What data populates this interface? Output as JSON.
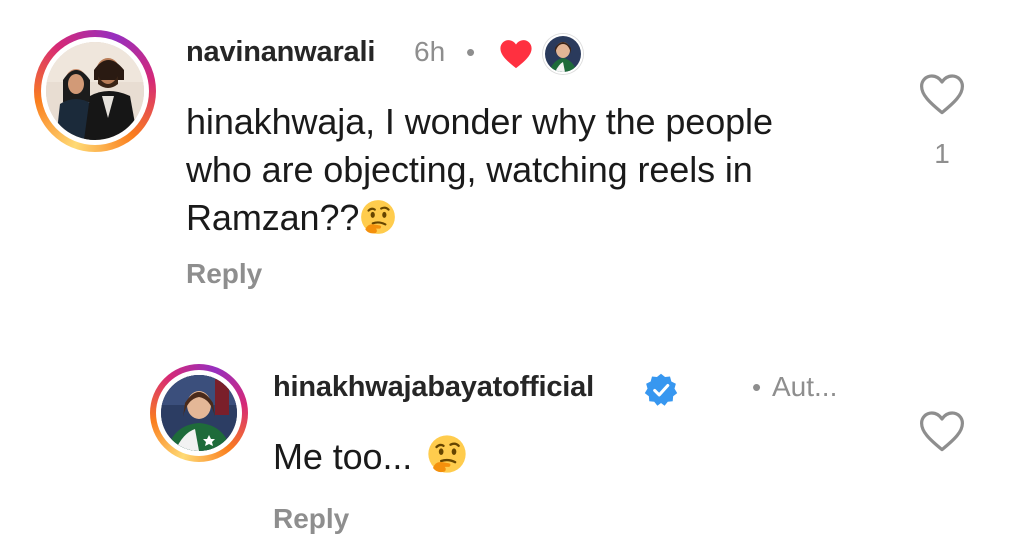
{
  "comments": [
    {
      "username": "navinanwarali",
      "time": "6h",
      "separator": "•",
      "text": "hinakhwaja, I wonder why the people who are objecting, watching reels in Ramzan??",
      "line1": "hinakhwaja, I wonder why the people",
      "line2": "who are objecting, watching reels in",
      "line3": "Ramzan??",
      "emoji": "thinking-face",
      "reply_label": "Reply",
      "like_count": "1",
      "liked_by_author": true
    },
    {
      "username": "hinakhwajabayatofficial",
      "verified": true,
      "separator": "•",
      "tag": "Aut...",
      "text": "Me too...",
      "emoji": "thinking-face",
      "reply_label": "Reply"
    }
  ],
  "colors": {
    "heart_red": "#ff3040",
    "verified_blue": "#3797f0",
    "muted_gray": "#8e8e8e"
  }
}
